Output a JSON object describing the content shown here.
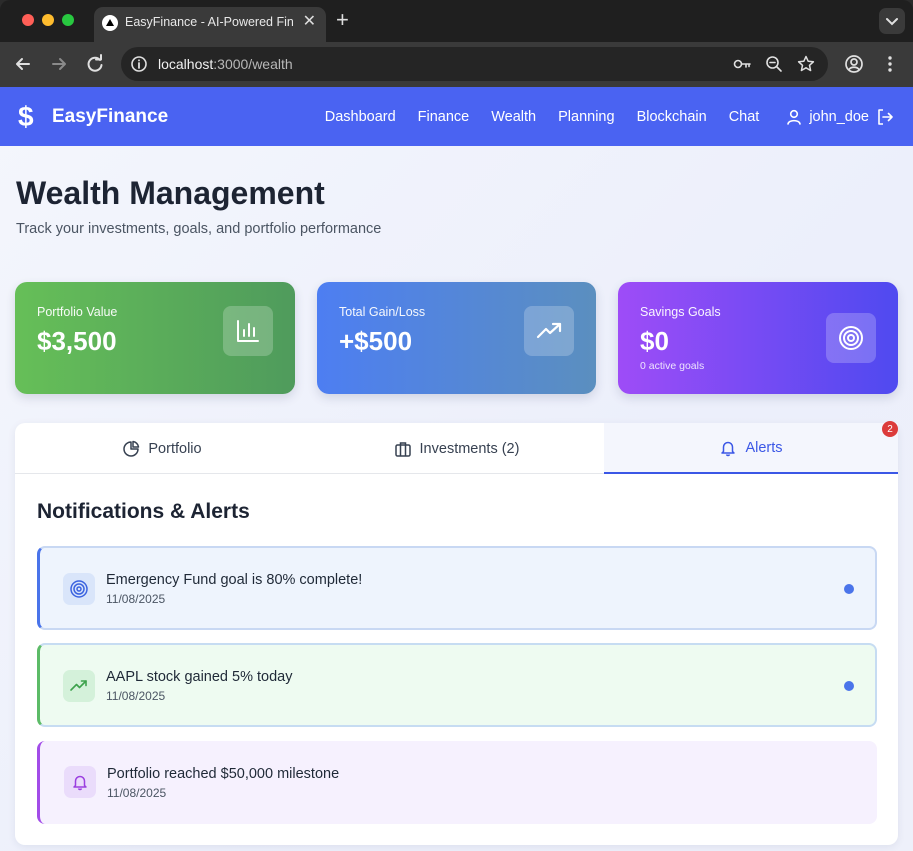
{
  "browser": {
    "tab_title": "EasyFinance - AI-Powered Finance",
    "tab_close": "✕",
    "new_tab": "+",
    "url_host": "localhost",
    "url_path": ":3000/wealth"
  },
  "app": {
    "brand_icon": "$",
    "brand_name": "EasyFinance",
    "nav": [
      "Dashboard",
      "Finance",
      "Wealth",
      "Planning",
      "Blockchain",
      "Chat"
    ],
    "username": "john_doe"
  },
  "header": {
    "title": "Wealth Management",
    "subtitle": "Track your investments, goals, and portfolio performance"
  },
  "stats": [
    {
      "label": "Portfolio Value",
      "value": "$3,500",
      "icon": "bar-chart-icon"
    },
    {
      "label": "Total Gain/Loss",
      "value": "+$500",
      "icon": "trending-up-icon"
    },
    {
      "label": "Savings Goals",
      "value": "$0",
      "note": "0 active goals",
      "icon": "target-icon"
    }
  ],
  "tabs": [
    {
      "label": "Portfolio",
      "icon": "pie-chart-icon"
    },
    {
      "label": "Investments (2)",
      "icon": "briefcase-icon"
    },
    {
      "label": "Alerts",
      "icon": "bell-icon",
      "badge": "2",
      "active": true
    }
  ],
  "alerts_section": {
    "title": "Notifications & Alerts",
    "items": [
      {
        "message": "Emergency Fund goal is 80% complete!",
        "date": "11/08/2025",
        "icon": "target-icon",
        "unread": true
      },
      {
        "message": "AAPL stock gained 5% today",
        "date": "11/08/2025",
        "icon": "trending-up-icon",
        "unread": true
      },
      {
        "message": "Portfolio reached $50,000 milestone",
        "date": "11/08/2025",
        "icon": "bell-icon",
        "unread": false
      }
    ]
  },
  "colors": {
    "nav_bg": "#4a63f2",
    "accent": "#3b57e6",
    "unread_dot": "#4a74ea",
    "badge": "#dc3b3b"
  }
}
